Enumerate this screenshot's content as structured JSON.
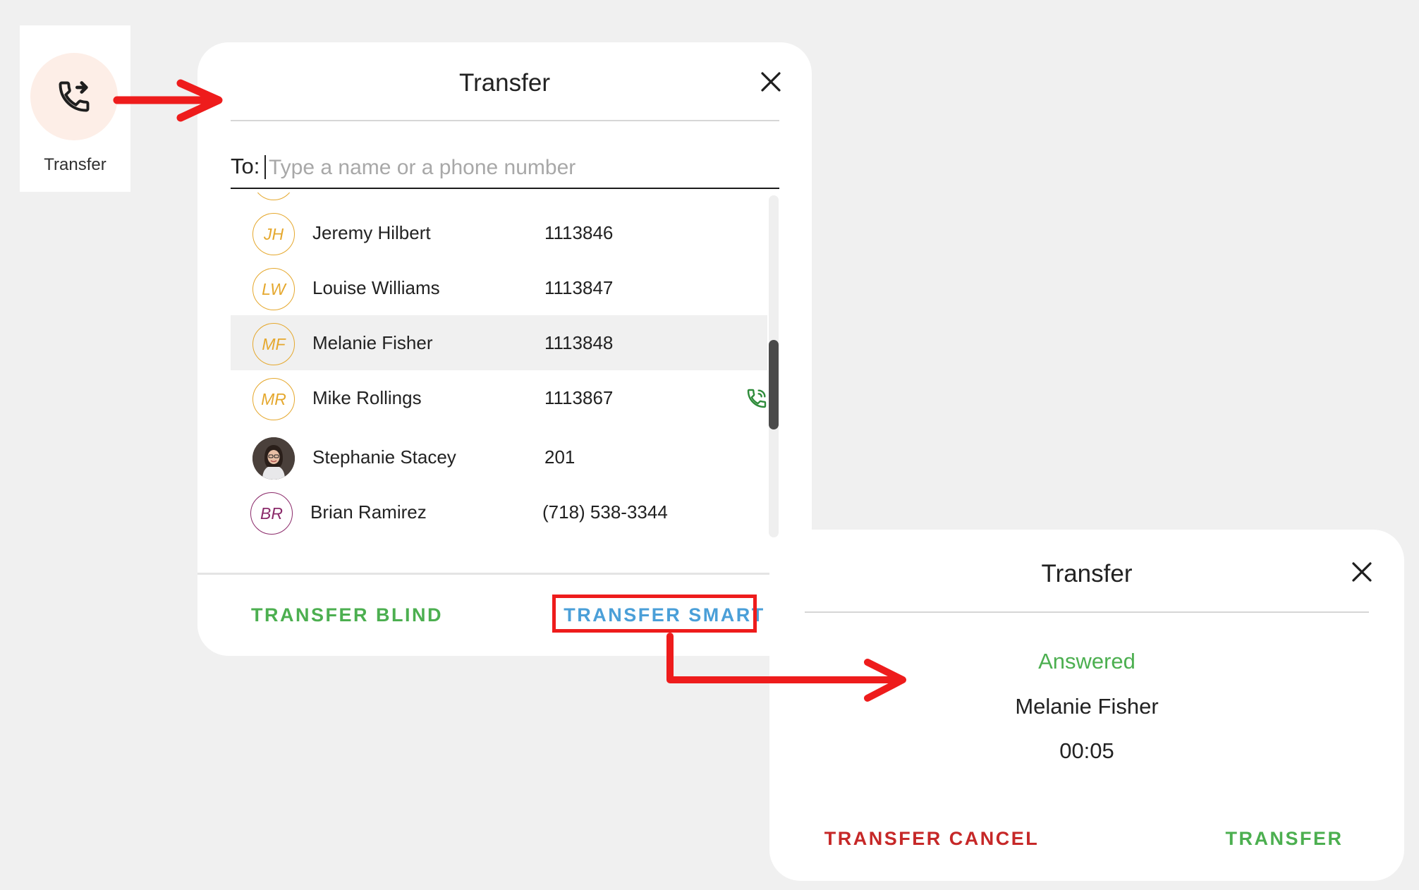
{
  "launcher": {
    "label": "Transfer",
    "icon": "phone-forward-icon"
  },
  "dialog1": {
    "title": "Transfer",
    "to_label": "To:",
    "search_placeholder": "Type a name or a phone number",
    "search_value": "",
    "contacts": [
      {
        "initials": "JH",
        "name": "Jeremy Hilbert",
        "number": "1113846"
      },
      {
        "initials": "LW",
        "name": "Louise Williams",
        "number": "1113847"
      },
      {
        "initials": "MF",
        "name": "Melanie Fisher",
        "number": "1113848",
        "selected": true
      },
      {
        "initials": "MR",
        "name": "Mike Rollings",
        "number": "1113867",
        "icon": "phone-in-call-icon"
      },
      {
        "initials": "",
        "name": "Stephanie Stacey",
        "number": "201",
        "avatar": "photo"
      },
      {
        "initials": "BR",
        "name": "Brian Ramirez",
        "number": "(718) 538-3344"
      }
    ],
    "blind_label": "TRANSFER BLIND",
    "smart_label": "TRANSFER SMART"
  },
  "dialog2": {
    "title": "Transfer",
    "status": "Answered",
    "callee": "Melanie Fisher",
    "timer": "00:05",
    "cancel_label": "TRANSFER CANCEL",
    "transfer_label": "TRANSFER"
  },
  "colors": {
    "accent_green": "#4caf50",
    "accent_blue": "#4a9fd8",
    "cancel_red": "#c62828",
    "annotation_red": "#ee1c1c",
    "avatar_gold": "#e5a82e",
    "avatar_purple": "#8b2a6a"
  }
}
